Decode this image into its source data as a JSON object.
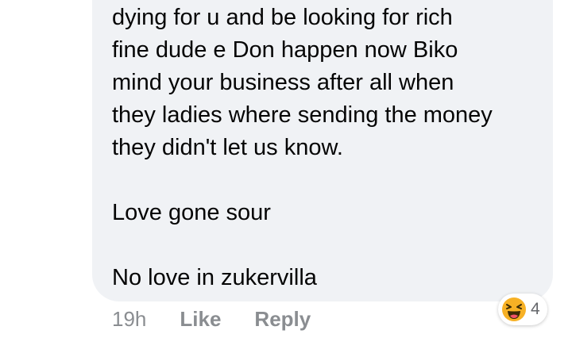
{
  "comment": {
    "lines": [
      "dying for u and be looking for rich",
      "fine dude e Don happen now Biko",
      "mind your business after all when",
      "they ladies where sending the money",
      "they didn't let us know.",
      "",
      "Love gone sour",
      "",
      "No love in zukervilla"
    ]
  },
  "meta": {
    "time": "19h",
    "like_label": "Like",
    "reply_label": "Reply"
  },
  "reactions": {
    "icon": "haha-emoji-icon",
    "count": "4",
    "icon_color": "#f7b125"
  },
  "colors": {
    "bubble": "#f0f2f5",
    "text": "#050505",
    "meta_text": "#8a8d91"
  }
}
